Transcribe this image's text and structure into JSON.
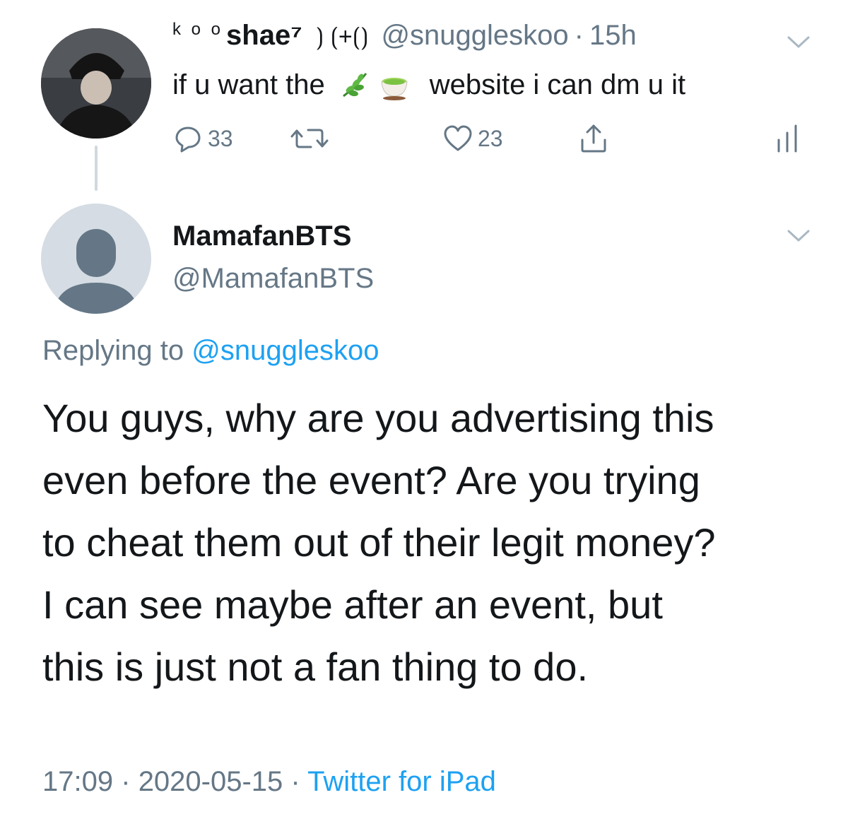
{
  "parent_tweet": {
    "display_name_prefix": "k o o",
    "display_name": "shae⁷",
    "name_symbols": "⟯ ⟮+⟮⟯",
    "handle": "@snuggleskoo",
    "separator": "·",
    "time": "15h",
    "text_before": "if u want the",
    "emojis": [
      "herb-icon",
      "tea-icon"
    ],
    "text_after": "website i can dm u it",
    "actions": {
      "reply_count": "33",
      "retweet_count": "",
      "like_count": "23"
    }
  },
  "reply_tweet": {
    "display_name": "MamafanBTS",
    "handle": "@MamafanBTS",
    "replying_prefix": "Replying to",
    "replying_to": "@snuggleskoo",
    "body_lines": [
      "You guys, why are you advertising this",
      "even before the event? Are you trying",
      "to cheat them out of their legit money?",
      "I can see maybe after an event, but",
      "this is just not a fan thing to do."
    ],
    "time": "17:09",
    "separator": "·",
    "date": "2020-05-15",
    "source": "Twitter for iPad"
  },
  "colors": {
    "text": "#14171a",
    "muted": "#657786",
    "link": "#1da1f2",
    "thread_line": "#cfd9de",
    "default_avatar_bg": "#d5dce3",
    "default_avatar_fg": "#657786"
  }
}
